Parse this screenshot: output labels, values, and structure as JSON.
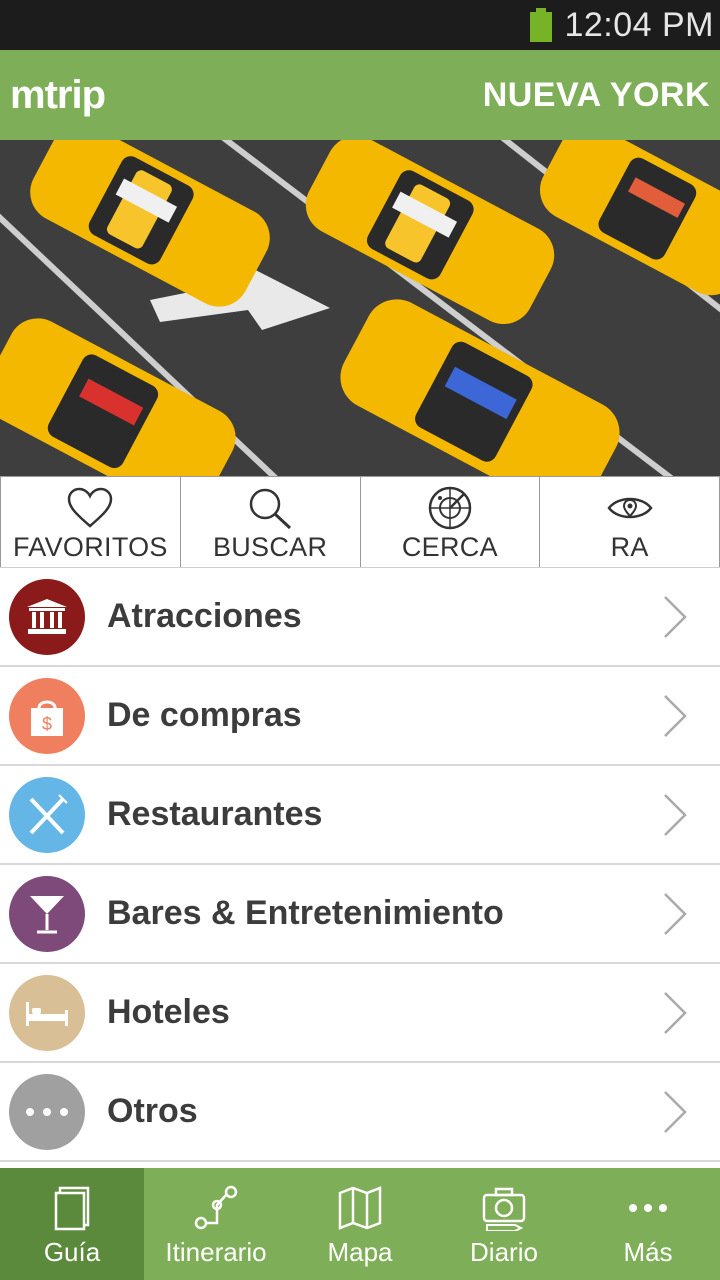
{
  "status_bar": {
    "time": "12:04 PM"
  },
  "header": {
    "logo": "mtrip",
    "city": "NUEVA YORK"
  },
  "quick_actions": [
    {
      "label": "FAVORITOS",
      "icon": "heart-icon"
    },
    {
      "label": "BUSCAR",
      "icon": "search-icon"
    },
    {
      "label": "CERCA",
      "icon": "radar-icon"
    },
    {
      "label": "RA",
      "icon": "eye-icon"
    }
  ],
  "categories": [
    {
      "label": "Atracciones",
      "icon": "museum-icon",
      "color": "#8b1a1a"
    },
    {
      "label": "De compras",
      "icon": "shopping-bag-icon",
      "color": "#ef7f5e"
    },
    {
      "label": "Restaurantes",
      "icon": "cutlery-icon",
      "color": "#63b6e6"
    },
    {
      "label": "Bares & Entretenimiento",
      "icon": "cocktail-icon",
      "color": "#7d4a7a"
    },
    {
      "label": "Hoteles",
      "icon": "bed-icon",
      "color": "#d8bf96"
    },
    {
      "label": "Otros",
      "icon": "more-icon",
      "color": "#a0a0a0"
    }
  ],
  "bottom_nav": [
    {
      "label": "Guía",
      "icon": "book-icon",
      "active": true
    },
    {
      "label": "Itinerario",
      "icon": "route-icon",
      "active": false
    },
    {
      "label": "Mapa",
      "icon": "map-icon",
      "active": false
    },
    {
      "label": "Diario",
      "icon": "camera-icon",
      "active": false
    },
    {
      "label": "Más",
      "icon": "more-dots-icon",
      "active": false
    }
  ],
  "colors": {
    "brand_green": "#7fae58",
    "active_green": "#5c8a3c",
    "status_bar": "#1c1c1c",
    "taxi_yellow": "#f5b800"
  }
}
